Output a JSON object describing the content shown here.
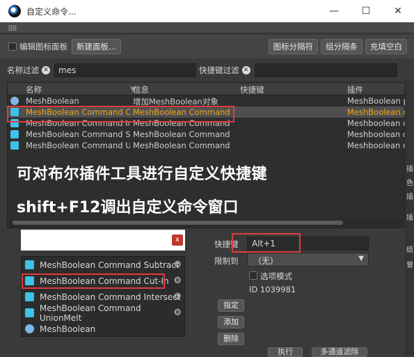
{
  "window": {
    "title": "自定义命令..."
  },
  "window_buttons": {
    "minimize": "—",
    "maximize": "☐",
    "close": "✕"
  },
  "toolbar": {
    "edit_icon_panel_label": "编辑图标面板",
    "new_panel_button": "新建面板...",
    "icon_separator_button": "图标分隔符",
    "group_separator_button": "组分隔条",
    "fill_space_button": "充填空白"
  },
  "filter": {
    "name_filter_label": "名称过滤",
    "name_filter_value": "mes",
    "shortcut_filter_label": "快捷键过滤",
    "shortcut_filter_value": ""
  },
  "table": {
    "columns": [
      "名称",
      "信息",
      "快捷键",
      "插件"
    ],
    "rows": [
      {
        "name": "MeshBoolean",
        "info": "增加MeshBoolean对象",
        "shortcut": "",
        "plugin": "MeshBoolean p",
        "icon": "boolean-icon",
        "selected": false
      },
      {
        "name": "MeshBoolean Command Cut",
        "info": "MeshBoolean Command",
        "shortcut": "",
        "plugin": "MeshBoolean c",
        "icon": "cut-in-icon",
        "selected": true
      },
      {
        "name": "MeshBoolean Command Inte",
        "info": "MeshBoolean Command",
        "shortcut": "",
        "plugin": "Meshboolean c",
        "icon": "intersect-icon",
        "selected": false
      },
      {
        "name": "MeshBoolean Command Subt",
        "info": "MeshBoolean Command",
        "shortcut": "",
        "plugin": "Meshboolean c",
        "icon": "subtract-icon",
        "selected": false
      },
      {
        "name": "MeshBoolean Command Uni",
        "info": "MeshBoolean Command",
        "shortcut": "",
        "plugin": "Meshboolean c",
        "icon": "union-icon",
        "selected": false
      }
    ]
  },
  "overlay": {
    "line1": "可对布尔插件工具进行自定义快捷键",
    "line2": "shift+F12调出自定义命令窗口"
  },
  "popup": {
    "search_value": "",
    "close_label": "x",
    "items": [
      {
        "label": "MeshBoolean Command Subtract",
        "icon": "subtract-icon"
      },
      {
        "label": "MeshBoolean Command Cut-In",
        "icon": "cut-in-icon"
      },
      {
        "label": "MeshBoolean Command Intersect",
        "icon": "intersect-icon"
      },
      {
        "label": "MeshBoolean Command UnionMelt",
        "icon": "union-icon"
      },
      {
        "label": "MeshBoolean",
        "icon": "boolean-icon"
      }
    ]
  },
  "details": {
    "shortcut_label": "快捷键",
    "shortcut_value": "Alt+1",
    "restrict_label": "限制到",
    "restrict_value": "（无）",
    "option_mode_label": "选项模式",
    "id_text": "ID 1039981",
    "assign_button": "指定",
    "add_button": "添加",
    "delete_button": "删除"
  },
  "side_panel": {
    "chars": [
      "插",
      "色",
      "插",
      "插",
      "结",
      "曾"
    ]
  },
  "bottom": {
    "execute_button": "执行",
    "multi_filter_button": "多通道滤除"
  },
  "colors": {
    "selected_text": "#f0a820",
    "highlight_box": "#e23b3b",
    "icon_cyan": "#3fc1e8"
  }
}
